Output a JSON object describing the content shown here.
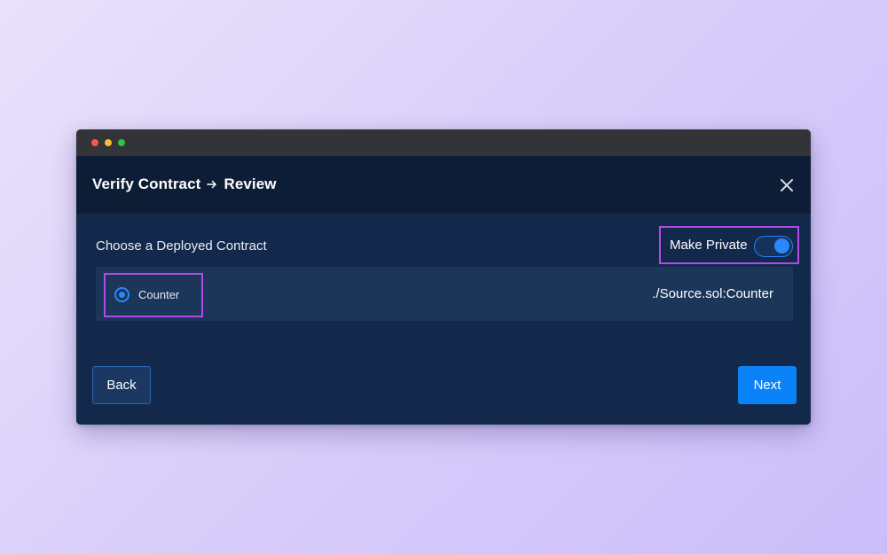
{
  "window": {
    "traffic_lights": [
      "close",
      "minimize",
      "maximize"
    ]
  },
  "header": {
    "title": "Verify Contract",
    "step": "Review",
    "arrow_icon": "arrow-right-icon",
    "close_icon": "close-icon"
  },
  "form": {
    "section_label": "Choose a Deployed Contract",
    "make_private_label": "Make Private",
    "make_private_enabled": true,
    "contracts": [
      {
        "name": "Counter",
        "path": "./Source.sol:Counter",
        "selected": true
      }
    ]
  },
  "footer": {
    "back_label": "Back",
    "next_label": "Next"
  },
  "colors": {
    "highlight": "#b04ae8",
    "accent": "#0a82f8",
    "panel": "#13294b"
  }
}
